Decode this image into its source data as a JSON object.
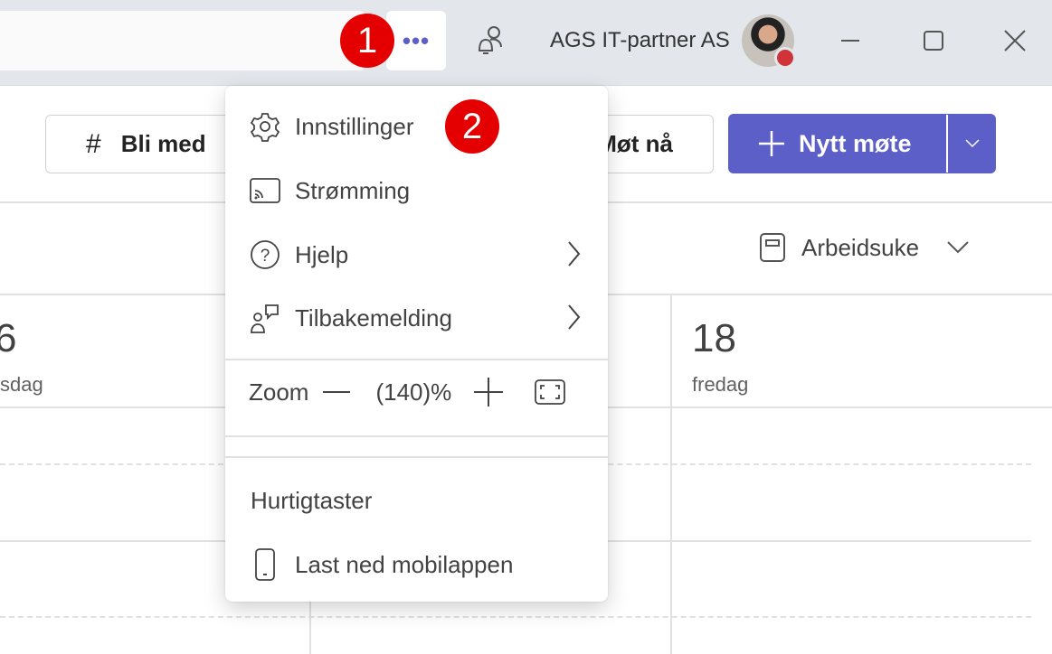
{
  "titlebar": {
    "more_label": "•••",
    "org_name": "AGS IT-partner AS",
    "status_color": "#d13438"
  },
  "annotations": {
    "step1": "1",
    "step2": "2",
    "color": "#e40000"
  },
  "toolbar": {
    "join_label": "Bli med",
    "meet_now_label": "Møt nå",
    "new_meeting_label": "Nytt møte",
    "accent": "#5b5fc7"
  },
  "view": {
    "label": "Arbeidsuke"
  },
  "days": [
    {
      "num": "6",
      "name": "sdag"
    },
    {
      "num": "18",
      "name": "fredag"
    }
  ],
  "menu": {
    "items": [
      {
        "label": "Innstillinger",
        "icon": "gear-icon"
      },
      {
        "label": "Strømming",
        "icon": "cast-icon"
      },
      {
        "label": "Hjelp",
        "icon": "help-icon"
      },
      {
        "label": "Tilbakemelding",
        "icon": "feedback-icon"
      }
    ],
    "zoom": {
      "label": "Zoom",
      "value": "(140)%"
    },
    "shortcuts": "Hurtigtaster",
    "mobile": "Last ned mobilappen"
  }
}
